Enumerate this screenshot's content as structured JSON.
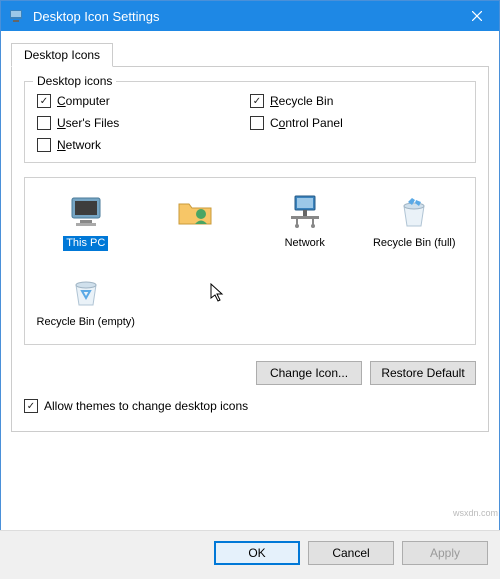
{
  "window": {
    "title": "Desktop Icon Settings"
  },
  "tab": {
    "label": "Desktop Icons"
  },
  "group": {
    "legend": "Desktop icons",
    "items": [
      {
        "label_pre": "",
        "underline": "C",
        "label_post": "omputer",
        "checked": true
      },
      {
        "label_pre": "",
        "underline": "R",
        "label_post": "ecycle Bin",
        "checked": true
      },
      {
        "label_pre": "",
        "underline": "U",
        "label_post": "ser's Files",
        "checked": false
      },
      {
        "label_pre": "C",
        "underline": "o",
        "label_post": "ntrol Panel",
        "checked": false
      },
      {
        "label_pre": "",
        "underline": "N",
        "label_post": "etwork",
        "checked": false
      }
    ]
  },
  "preview": {
    "icons": [
      {
        "label": "This PC",
        "selected": true,
        "kind": "computer"
      },
      {
        "label": "",
        "selected": false,
        "kind": "userfolder"
      },
      {
        "label": "Network",
        "selected": false,
        "kind": "network"
      },
      {
        "label": "Recycle Bin (full)",
        "selected": false,
        "kind": "bin-full"
      },
      {
        "label": "Recycle Bin (empty)",
        "selected": false,
        "kind": "bin-empty"
      }
    ]
  },
  "buttons": {
    "change_icon": "Change Icon...",
    "restore_default": "Restore Default"
  },
  "allow_themes": {
    "label": "Allow themes to change desktop icons",
    "checked": true
  },
  "footer": {
    "ok": "OK",
    "cancel": "Cancel",
    "apply": "Apply"
  },
  "watermark": "wsxdn.com"
}
